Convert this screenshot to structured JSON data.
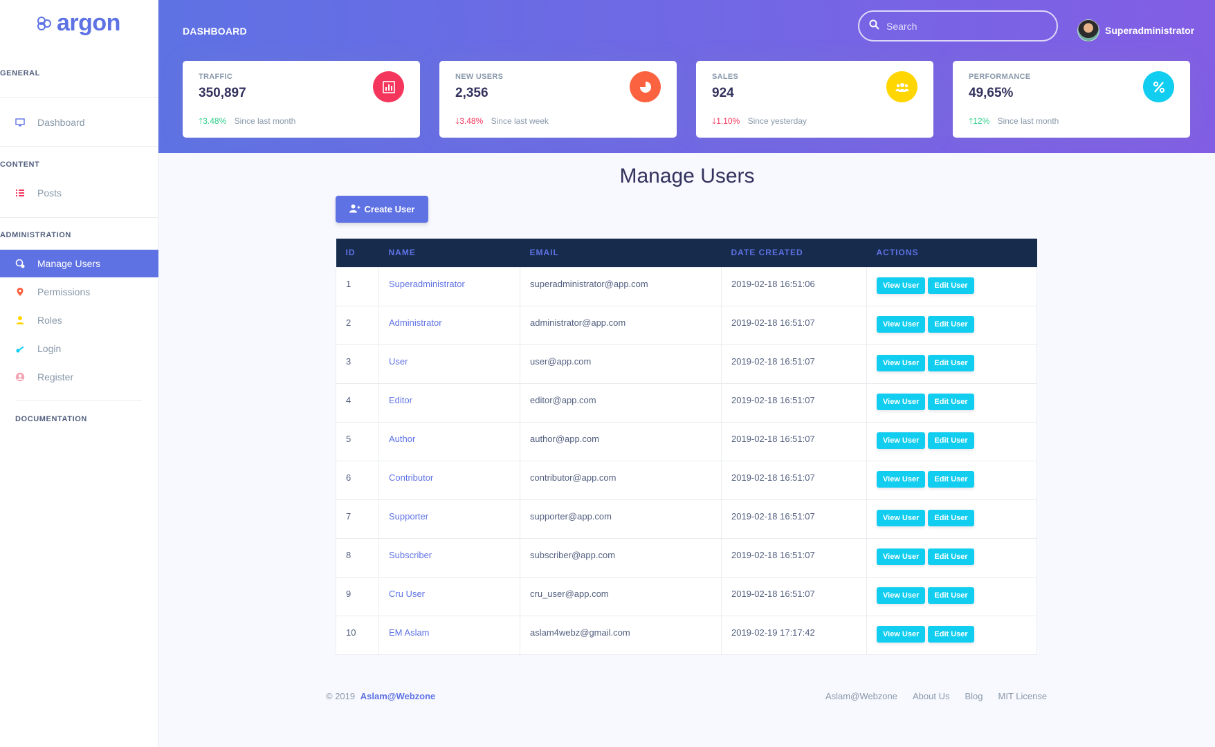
{
  "brand": {
    "name": "argon"
  },
  "sidebar": {
    "sections": [
      {
        "title": "GENERAL"
      },
      {
        "title": "CONTENT"
      },
      {
        "title": "ADMINISTRATION"
      },
      {
        "title": "DOCUMENTATION"
      }
    ],
    "items": [
      {
        "label": "Dashboard",
        "icon": "monitor-icon"
      },
      {
        "label": "Posts",
        "icon": "list-icon"
      },
      {
        "label": "Manage Users",
        "icon": "users-icon",
        "active": true
      },
      {
        "label": "Permissions",
        "icon": "pin-icon"
      },
      {
        "label": "Roles",
        "icon": "person-icon"
      },
      {
        "label": "Login",
        "icon": "key-icon"
      },
      {
        "label": "Register",
        "icon": "user-circle-icon"
      }
    ]
  },
  "header": {
    "title": "DASHBOARD",
    "search_placeholder": "Search",
    "user_name": "Superadministrator"
  },
  "cards": [
    {
      "title": "TRAFFIC",
      "value": "350,897",
      "change": "3.48%",
      "direction": "up",
      "since": "Since last month",
      "color": "#f5365c",
      "icon": "bar-chart-icon"
    },
    {
      "title": "NEW USERS",
      "value": "2,356",
      "change": "3.48%",
      "direction": "down",
      "since": "Since last week",
      "color": "#fb6340",
      "icon": "pie-chart-icon"
    },
    {
      "title": "SALES",
      "value": "924",
      "change": "1.10%",
      "direction": "down",
      "since": "Since yesterday",
      "color": "#ffd600",
      "icon": "users-icon"
    },
    {
      "title": "PERFORMANCE",
      "value": "49,65%",
      "change": "12%",
      "direction": "up",
      "since": "Since last month",
      "color": "#11cdef",
      "icon": "percent-icon"
    }
  ],
  "main": {
    "title": "Manage Users",
    "create_label": "Create User",
    "columns": [
      "ID",
      "NAME",
      "EMAIL",
      "DATE CREATED",
      "ACTIONS"
    ],
    "view_label": "View User",
    "edit_label": "Edit User",
    "rows": [
      {
        "id": "1",
        "name": "Superadministrator",
        "email": "superadministrator@app.com",
        "created": "2019-02-18 16:51:06"
      },
      {
        "id": "2",
        "name": "Administrator",
        "email": "administrator@app.com",
        "created": "2019-02-18 16:51:07"
      },
      {
        "id": "3",
        "name": "User",
        "email": "user@app.com",
        "created": "2019-02-18 16:51:07"
      },
      {
        "id": "4",
        "name": "Editor",
        "email": "editor@app.com",
        "created": "2019-02-18 16:51:07"
      },
      {
        "id": "5",
        "name": "Author",
        "email": "author@app.com",
        "created": "2019-02-18 16:51:07"
      },
      {
        "id": "6",
        "name": "Contributor",
        "email": "contributor@app.com",
        "created": "2019-02-18 16:51:07"
      },
      {
        "id": "7",
        "name": "Supporter",
        "email": "supporter@app.com",
        "created": "2019-02-18 16:51:07"
      },
      {
        "id": "8",
        "name": "Subscriber",
        "email": "subscriber@app.com",
        "created": "2019-02-18 16:51:07"
      },
      {
        "id": "9",
        "name": "Cru User",
        "email": "cru_user@app.com",
        "created": "2019-02-18 16:51:07"
      },
      {
        "id": "10",
        "name": "EM Aslam",
        "email": "aslam4webz@gmail.com",
        "created": "2019-02-19 17:17:42"
      }
    ]
  },
  "footer": {
    "copyright": "© 2019",
    "brand_link": "Aslam@Webzone",
    "links": [
      "Aslam@Webzone",
      "About Us",
      "Blog",
      "MIT License"
    ]
  },
  "colors": {
    "primary": "#5e72e4",
    "info": "#11cdef",
    "success": "#2dce89",
    "danger": "#f5365c",
    "table_head": "#172b4d"
  }
}
